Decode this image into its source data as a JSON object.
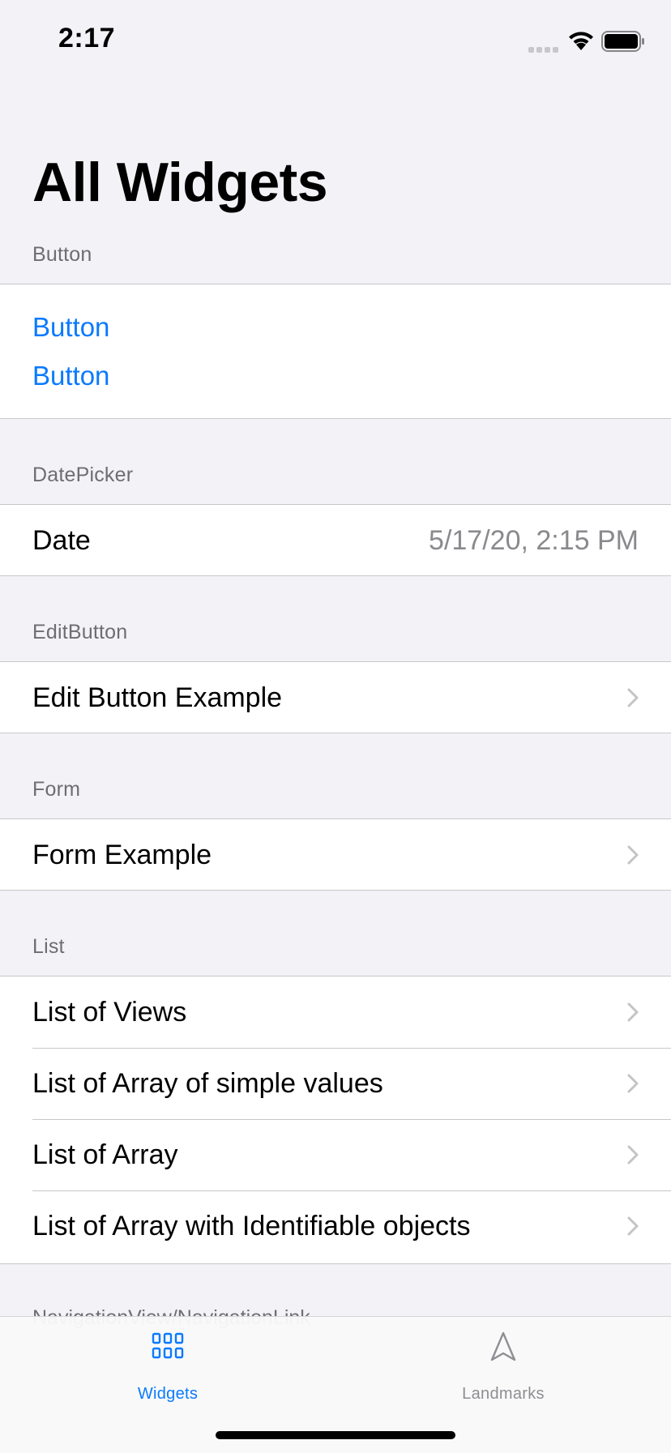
{
  "status_bar": {
    "time": "2:17"
  },
  "navigation": {
    "title": "All Widgets"
  },
  "sections": {
    "button": {
      "header": "Button",
      "buttons": [
        "Button",
        "Button"
      ]
    },
    "datepicker": {
      "header": "DatePicker",
      "row_label": "Date",
      "row_value": "5/17/20, 2:15 PM"
    },
    "editbutton": {
      "header": "EditButton",
      "row_label": "Edit Button Example"
    },
    "form": {
      "header": "Form",
      "row_label": "Form Example"
    },
    "list": {
      "header": "List",
      "rows": [
        "List of Views",
        "List of Array of simple values",
        "List of Array",
        "List of Array with Identifiable objects"
      ]
    },
    "navigation_peek": {
      "header": "NavigationView/NavigationLink"
    }
  },
  "tab_bar": {
    "tabs": [
      {
        "label": "Widgets",
        "icon": "grid-icon",
        "selected": true
      },
      {
        "label": "Landmarks",
        "icon": "location-arrow-icon",
        "selected": false
      }
    ]
  },
  "colors": {
    "accent": "#0A7AFF",
    "background": "#F2F2F7",
    "secondary_text": "#8A8A8E",
    "inactive_tab": "#8E8E93"
  }
}
